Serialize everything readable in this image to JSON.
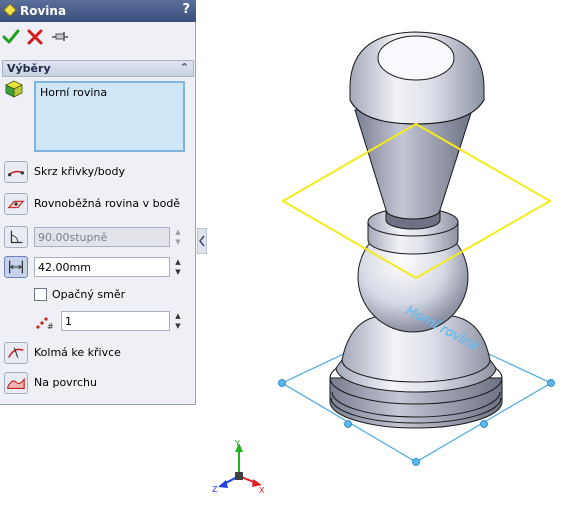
{
  "window": {
    "title": "Rovina",
    "help_label": "?"
  },
  "toolbar": {
    "ok_icon": "check-icon",
    "cancel_icon": "close-icon",
    "pin_icon": "pushpin-icon"
  },
  "selections": {
    "header": "Výběry",
    "selected_item": "Horní rovina"
  },
  "options": {
    "through_curves_label": "Skrz křivky/body",
    "parallel_plane_label": "Rovnoběžná rovina v bodě",
    "angle_value": "90.00stupně",
    "offset_value": "42.00mm",
    "flip_label": "Opačný směr",
    "flip_checked": false,
    "count_value": "1",
    "normal_to_curve_label": "Kolmá ke křivce",
    "on_surface_label": "Na povrchu"
  },
  "viewport": {
    "plane_label": "Horní rovina",
    "triad": {
      "x": "X",
      "y": "Y",
      "z": "Z"
    },
    "colors": {
      "plane_preview": "#f2ec1c",
      "reference_plane": "#4aa8e8",
      "axis_x": "#e02020",
      "axis_y": "#20b020",
      "axis_z": "#2040e0"
    }
  }
}
